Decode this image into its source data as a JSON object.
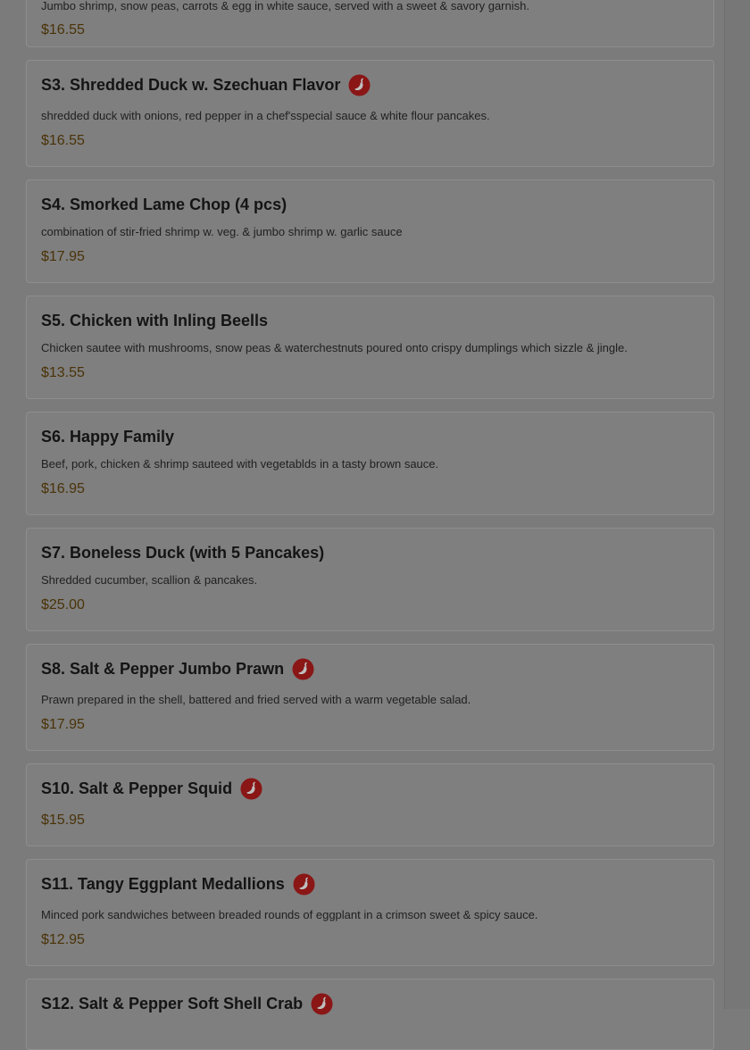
{
  "accent_colors": {
    "price": "#4a3308",
    "spicy_icon": "#8a1616",
    "overlay": "#7b7b7b"
  },
  "partial_top_item": {
    "description": "Jumbo shrimp, snow peas, carrots & egg in white sauce, served with a sweet & savory garnish.",
    "price": "$16.55"
  },
  "items": [
    {
      "title": "S3. Shredded Duck w. Szechuan Flavor",
      "spicy": true,
      "icon": "spicy-pepper-icon",
      "description": "shredded duck with onions, red pepper in a chef'sspecial sauce & white flour pancakes.",
      "price": "$16.55"
    },
    {
      "title": "S4. Smorked Lame Chop (4 pcs)",
      "spicy": false,
      "description": "combination of stir-fried shrimp w. veg. & jumbo shrimp w. garlic sauce",
      "price": "$17.95"
    },
    {
      "title": "S5. Chicken with Inling Beells",
      "spicy": false,
      "description": "Chicken sautee with mushrooms, snow peas & waterchestnuts poured onto crispy dumplings which sizzle & jingle.",
      "price": "$13.55"
    },
    {
      "title": "S6. Happy Family",
      "spicy": false,
      "description": "Beef, pork, chicken & shrimp sauteed with vegetablds in a tasty brown sauce.",
      "price": "$16.95"
    },
    {
      "title": "S7. Boneless Duck (with 5 Pancakes)",
      "spicy": false,
      "description": "Shredded cucumber, scallion & pancakes.",
      "price": "$25.00"
    },
    {
      "title": "S8. Salt & Pepper Jumbo Prawn",
      "spicy": true,
      "icon": "spicy-pepper-icon",
      "description": "Prawn prepared in the shell, battered and fried served with a warm vegetable salad.",
      "price": "$17.95"
    },
    {
      "title": "S10. Salt & Pepper Squid",
      "spicy": true,
      "icon": "spicy-pepper-icon",
      "description": "",
      "price": "$15.95"
    },
    {
      "title": "S11. Tangy Eggplant Medallions",
      "spicy": true,
      "icon": "spicy-pepper-icon",
      "description": "Minced pork sandwiches between breaded rounds of eggplant in a crimson sweet & spicy sauce.",
      "price": "$12.95"
    },
    {
      "title": "S12. Salt & Pepper Soft Shell Crab",
      "spicy": true,
      "icon": "spicy-pepper-icon",
      "description": "",
      "price": ""
    }
  ]
}
